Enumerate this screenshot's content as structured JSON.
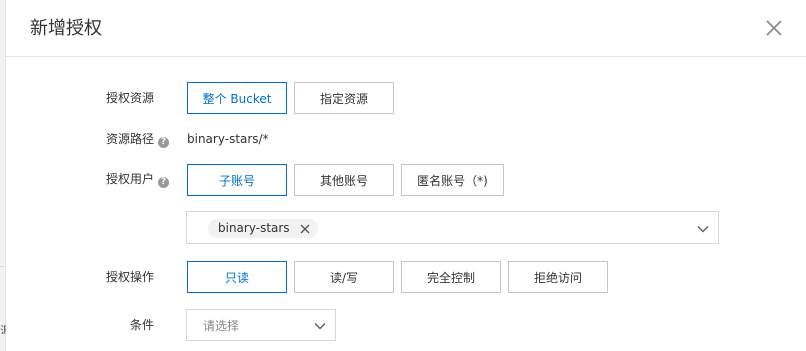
{
  "dialog": {
    "title": "新增授权"
  },
  "left_strip": {
    "glyph": "源"
  },
  "resource": {
    "label": "授权资源",
    "options": [
      "整个 Bucket",
      "指定资源"
    ],
    "selected": "整个 Bucket"
  },
  "path": {
    "label": "资源路径",
    "value": "binary-stars/*"
  },
  "user": {
    "label": "授权用户",
    "options": [
      "子账号",
      "其他账号",
      "匿名账号（*)"
    ],
    "selected": "子账号",
    "selected_tags": [
      "binary-stars"
    ]
  },
  "operation": {
    "label": "授权操作",
    "options": [
      "只读",
      "读/写",
      "完全控制",
      "拒绝访问"
    ],
    "selected": "只读"
  },
  "condition": {
    "label": "条件",
    "placeholder": "请选择"
  },
  "colors": {
    "accent": "#0070cc",
    "border": "#c6c6c6",
    "tag_bg": "#f2f2f2"
  }
}
